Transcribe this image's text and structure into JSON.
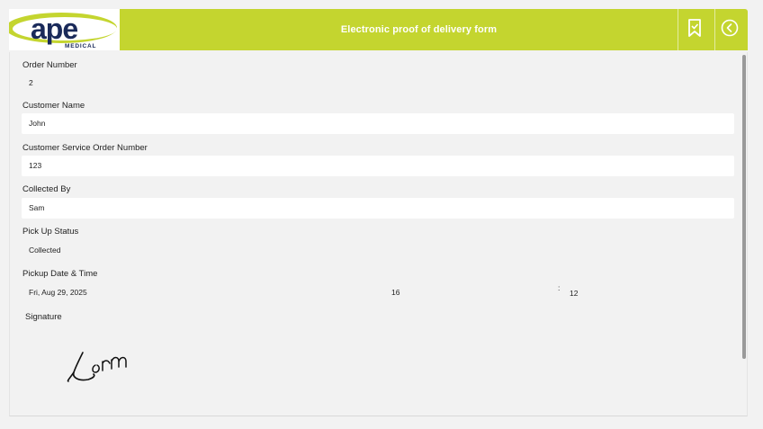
{
  "header": {
    "title": "Electronic proof of delivery form",
    "logo_word": "ape",
    "logo_sub": "MEDICAL",
    "colors": {
      "brand": "#c4d52f",
      "logo_text": "#1a2a5a"
    },
    "bookmark_icon": "bookmark-icon",
    "back_icon": "back-circle-icon"
  },
  "form": {
    "order_number": {
      "label": "Order Number",
      "value": "2"
    },
    "customer_name": {
      "label": "Customer Name",
      "value": "John"
    },
    "cs_order_number": {
      "label": "Customer Service Order Number",
      "value": "123"
    },
    "collected_by": {
      "label": "Collected By",
      "value": "Sam"
    },
    "pickup_status": {
      "label": "Pick Up Status",
      "value": "Collected"
    },
    "pickup_datetime": {
      "label": "Pickup Date & Time",
      "date": "Fri, Aug 29, 2025",
      "hour": "16",
      "separator": ":",
      "minute": "12"
    },
    "signature": {
      "label": "Signature"
    }
  }
}
